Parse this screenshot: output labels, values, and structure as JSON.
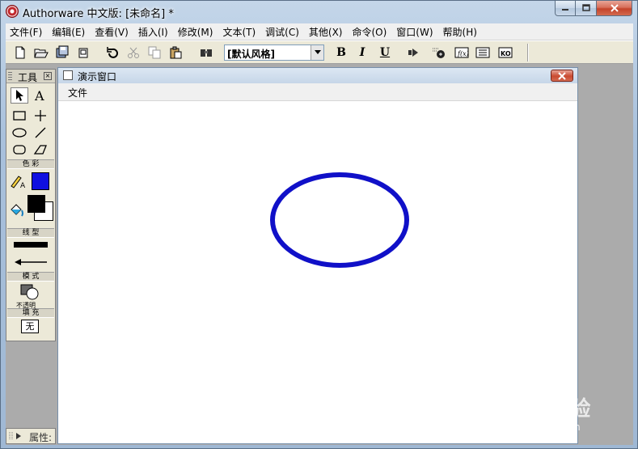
{
  "window": {
    "title": "Authorware 中文版: [未命名] *"
  },
  "menubar": {
    "items": [
      "文件(F)",
      "编辑(E)",
      "查看(V)",
      "插入(I)",
      "修改(M)",
      "文本(T)",
      "调试(C)",
      "其他(X)",
      "命令(O)",
      "窗口(W)",
      "帮助(H)"
    ]
  },
  "toolbar": {
    "style_combo_value": "[默认风格]",
    "bold_label": "B",
    "italic_label": "I",
    "underline_label": "U"
  },
  "tools_palette": {
    "title": "工具",
    "sections": {
      "color": "色 彩",
      "line": "线 型",
      "mode": "模 式",
      "fill": "填 充"
    },
    "mode_value": "不透明",
    "fill_value": "无",
    "colors": {
      "text_color": "#1010e0",
      "fill_foreground": "#000000",
      "fill_background": "#ffffff"
    }
  },
  "properties_bar": {
    "label": "属性:"
  },
  "presentation_window": {
    "title": "演示窗口",
    "menu": [
      "文件"
    ],
    "ellipse_color": "#1010c8"
  },
  "watermark": {
    "text": "Baidu经验",
    "url": "jingyan.baidu.com"
  }
}
